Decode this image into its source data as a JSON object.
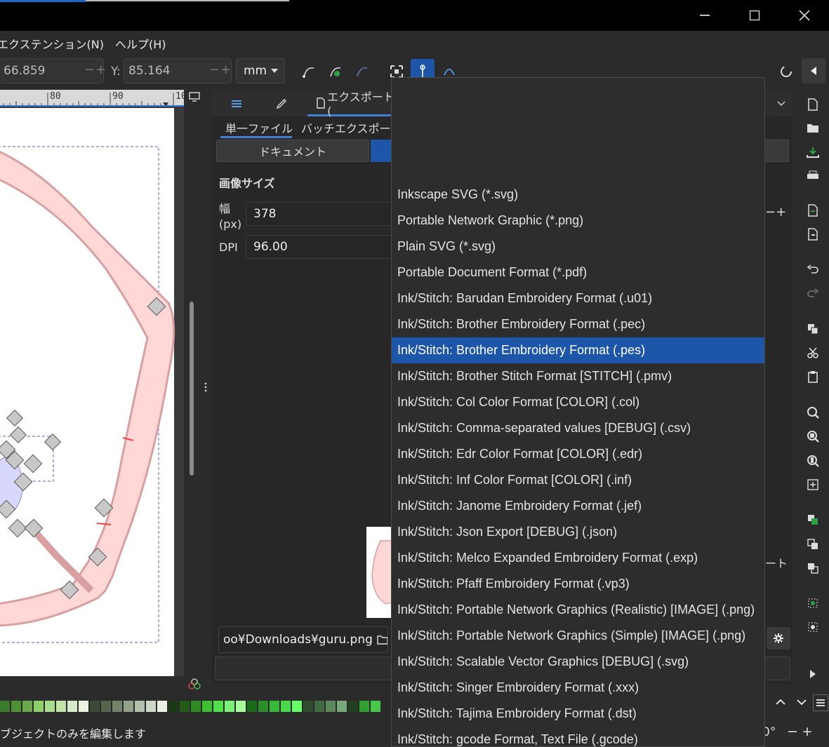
{
  "menubar": {
    "items": [
      "エクステンション(N)",
      "ヘルプ(H)"
    ]
  },
  "toolbar": {
    "x_value": "66.859",
    "y_label": "Y:",
    "y_value": "85.164",
    "unit": "mm",
    "stepper_minus": "−",
    "stepper_plus": "+"
  },
  "ruler": {
    "ticks": [
      "80",
      "90",
      "10"
    ]
  },
  "panel": {
    "tab_export_label": "エクスポート(",
    "subtab_single": "単一ファイル",
    "subtab_batch": "バッチエクスポート",
    "area_document": "ドキュメント",
    "image_size_heading": "画像サイズ",
    "width_label": "幅",
    "width_unit": "(px)",
    "width_value": "378",
    "dpi_label": "DPI",
    "dpi_value": "96.00",
    "filename": "oo¥Downloads¥guru.png",
    "export_partial": "ート"
  },
  "dropdown": {
    "selected_index": 6,
    "options": [
      "Inkscape SVG (*.svg)",
      "Portable Network Graphic (*.png)",
      "Plain SVG (*.svg)",
      "Portable Document Format (*.pdf)",
      "Ink/Stitch: Barudan Embroidery Format (.u01)",
      "Ink/Stitch: Brother Embroidery Format (.pec)",
      "Ink/Stitch: Brother Embroidery Format (.pes)",
      "Ink/Stitch: Brother Stitch Format [STITCH] (.pmv)",
      "Ink/Stitch: Col Color Format [COLOR] (.col)",
      "Ink/Stitch: Comma-separated values [DEBUG] (.csv)",
      "Ink/Stitch: Edr Color Format [COLOR] (.edr)",
      "Ink/Stitch: Inf Color Format [COLOR] (.inf)",
      "Ink/Stitch: Janome Embroidery Format (.jef)",
      "Ink/Stitch: Json Export [DEBUG] (.json)",
      "Ink/Stitch: Melco Expanded Embroidery Format (.exp)",
      "Ink/Stitch: Pfaff Embroidery Format (.vp3)",
      "Ink/Stitch: Portable Network Graphics (Realistic) [IMAGE] (.png)",
      "Ink/Stitch: Portable Network Graphics (Simple) [IMAGE] (.png)",
      "Ink/Stitch: Scalable Vector Graphics [DEBUG] (.svg)",
      "Ink/Stitch: Singer Embroidery Format (.xxx)",
      "Ink/Stitch: Tajima Embroidery Format (.dst)",
      "Ink/Stitch: gcode Format, Text File (.gcode)"
    ]
  },
  "status": {
    "message": "ブジェクトのみを編集します",
    "rotation_partial": "0°"
  },
  "colors": {
    "accent": "#1d55a8",
    "background": "#2b2b2b",
    "shape_fill": "#ffd7d7"
  },
  "palette": [
    "#3a7a2a",
    "#4f8f35",
    "#6aa84a",
    "#8fcf6a",
    "#a8dc8a",
    "#c0e4a8",
    "#d6ecc8",
    "#e8f4e0",
    "#3d4a36",
    "#56664c",
    "#73846a",
    "#93a38a",
    "#b2bfaa",
    "#cfd8c8",
    "#ebefe6",
    "#1a3a14",
    "#225a18",
    "#2f8a22",
    "#3fbf2f",
    "#52e04a",
    "#7cf07a",
    "#a6ff9a",
    "#1c6a1c",
    "#2a8f2a",
    "#38b838",
    "#4ad84a",
    "#66ff66",
    "#2d4d2d",
    "#416b41",
    "#5a8a5a",
    "#77aa77",
    "#1f3f1f",
    "#30a030",
    "#48c848"
  ]
}
